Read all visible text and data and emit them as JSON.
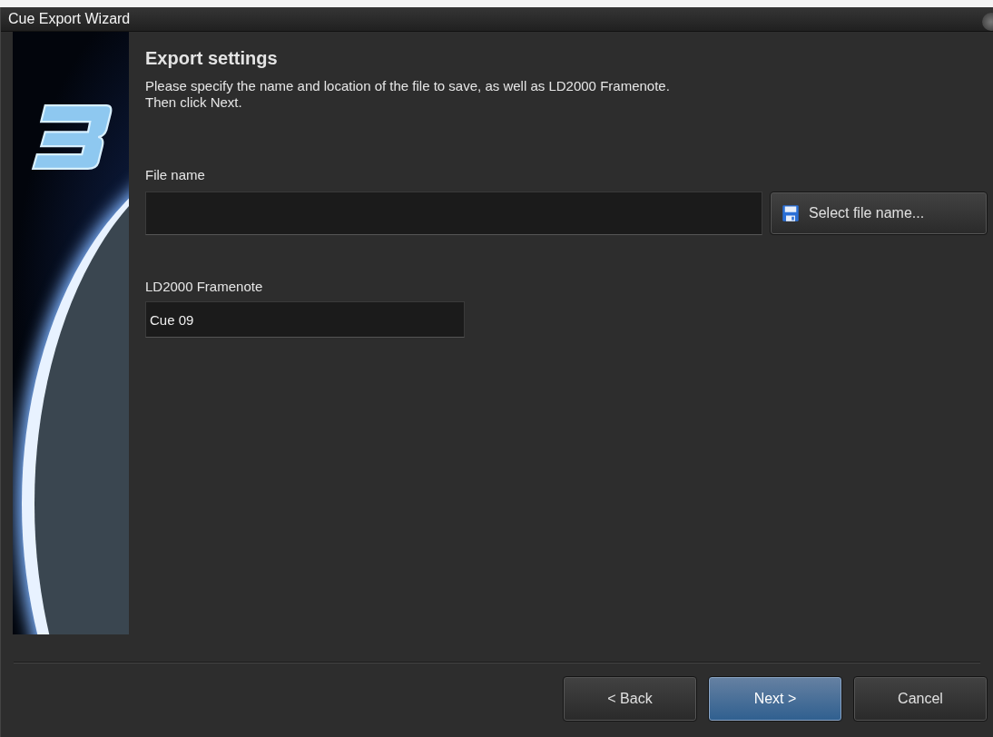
{
  "window": {
    "title": "Cue Export Wizard"
  },
  "page": {
    "heading": "Export settings",
    "instructions": [
      "Please specify the name and location of the file to save, as well as LD2000 Framenote.",
      "Then click Next."
    ]
  },
  "file_name": {
    "label": "File name",
    "button": "Select file name..."
  },
  "framenote": {
    "label": "LD2000 Framenote",
    "value": "Cue 09"
  },
  "buttons": [
    {
      "label": "< Back",
      "default": false
    },
    {
      "label": "Next >",
      "default": true
    },
    {
      "label": "Cancel",
      "default": false
    }
  ]
}
